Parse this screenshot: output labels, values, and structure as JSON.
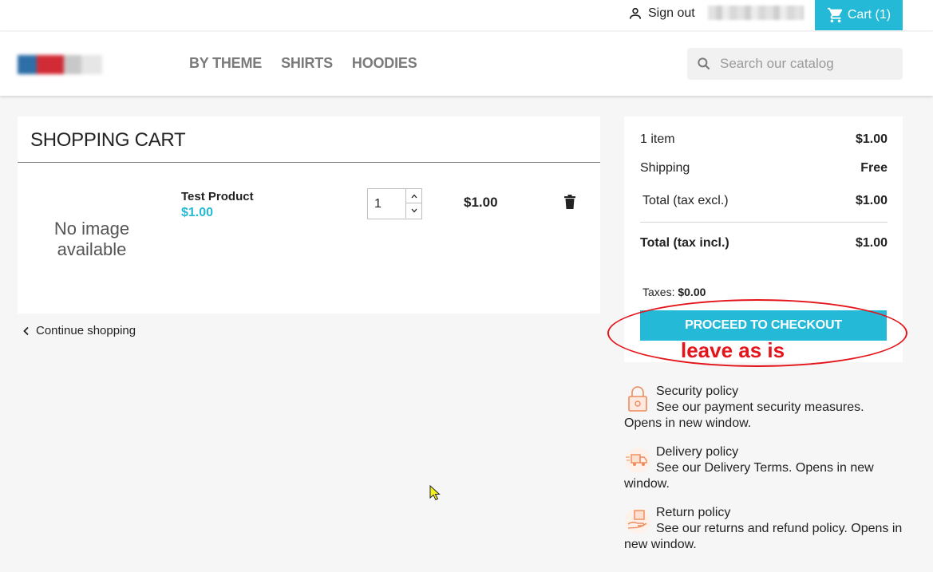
{
  "header": {
    "sign_out": "Sign out",
    "cart_label": "Cart (1)"
  },
  "nav": {
    "menu": [
      "BY THEME",
      "SHIRTS",
      "HOODIES"
    ],
    "search_placeholder": "Search our catalog"
  },
  "cart": {
    "title": "SHOPPING CART",
    "no_image_line1": "No image",
    "no_image_line2": "available",
    "product_name": "Test Product",
    "product_price": "$1.00",
    "quantity": "1",
    "line_total": "$1.00",
    "continue_shopping": "Continue shopping"
  },
  "summary": {
    "items_label": "1 item",
    "items_value": "$1.00",
    "shipping_label": "Shipping",
    "shipping_value": "Free",
    "total_excl_label": "Total (tax excl.)",
    "total_excl_value": "$1.00",
    "total_incl_label": "Total (tax incl.)",
    "total_incl_value": "$1.00",
    "taxes_label": "Taxes:",
    "taxes_value": "$0.00",
    "checkout_button": "PROCEED TO CHECKOUT"
  },
  "annotation": {
    "text": "leave as is",
    "color": "#e4141b"
  },
  "reassurance": [
    {
      "title": "Security policy",
      "desc": "See our payment security measures. Opens in new window."
    },
    {
      "title": "Delivery policy",
      "desc": "See our Delivery Terms. Opens in new window."
    },
    {
      "title": "Return policy",
      "desc": "See our returns and refund policy. Opens in new window."
    }
  ],
  "colors": {
    "accent": "#24b9d7",
    "background": "#f6f6f6",
    "reassurance_icon": "#f08a5b"
  }
}
